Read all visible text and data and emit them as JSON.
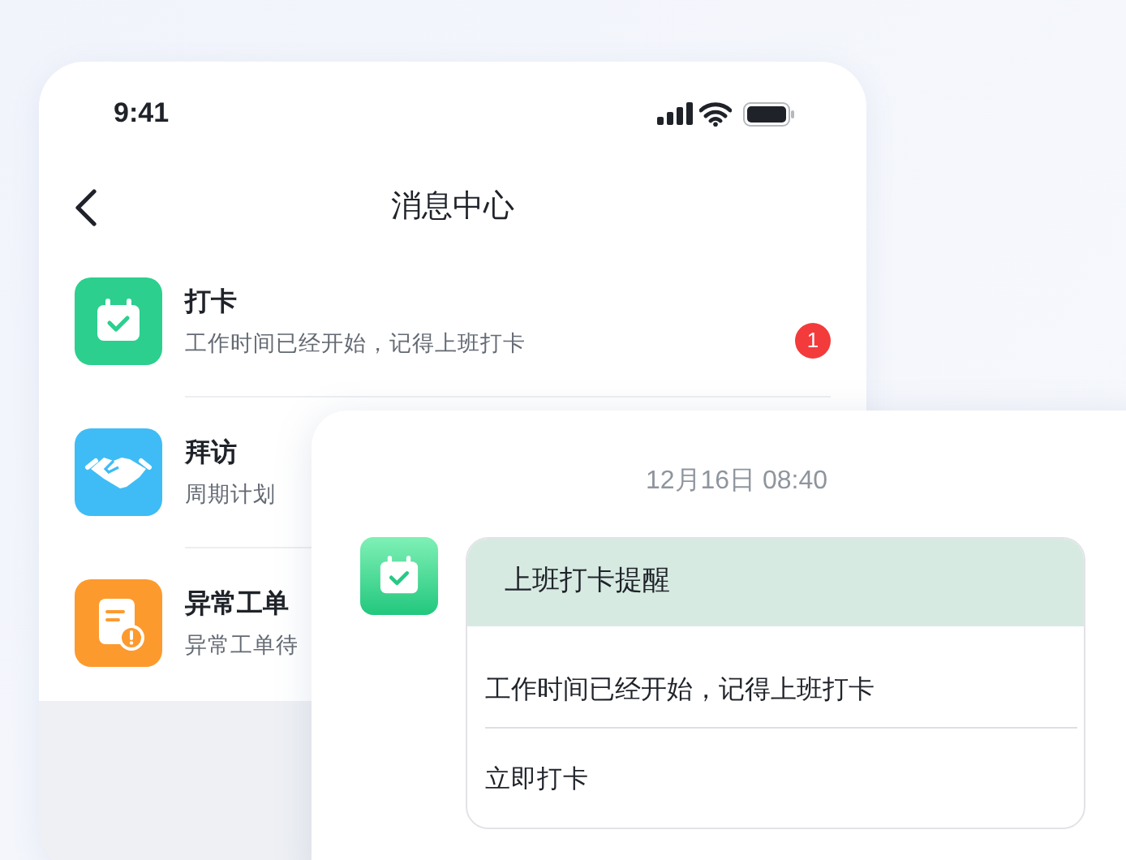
{
  "status_bar": {
    "time": "9:41"
  },
  "header": {
    "title": "消息中心"
  },
  "messages": [
    {
      "kind": "checkin",
      "title": "打卡",
      "preview": "工作时间已经开始，记得上班打卡",
      "badge": "1"
    },
    {
      "kind": "visit",
      "title": "拜访",
      "preview": "周期计划"
    },
    {
      "kind": "exception",
      "title": "异常工单",
      "preview": "异常工单待"
    }
  ],
  "notification": {
    "timestamp": "12月16日 08:40",
    "kind": "checkin",
    "title": "上班打卡提醒",
    "body": "工作时间已经开始，记得上班打卡",
    "action": "立即打卡"
  }
}
